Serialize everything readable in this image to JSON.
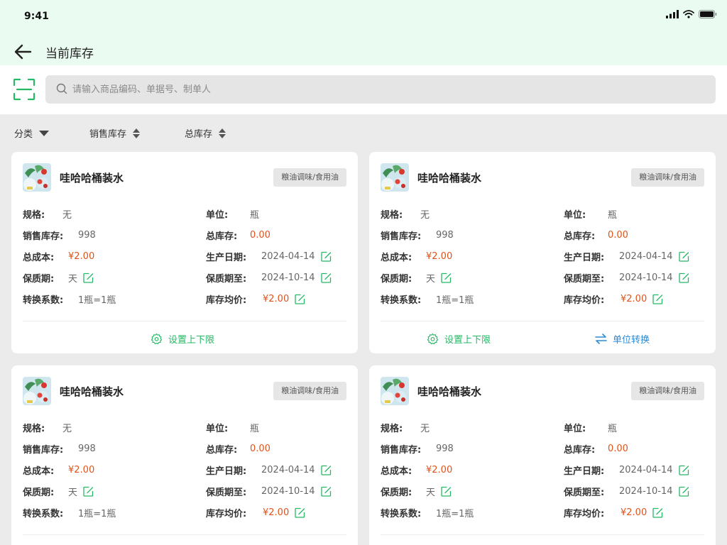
{
  "status": {
    "time": "9:41"
  },
  "header": {
    "title": "当前库存"
  },
  "search": {
    "placeholder": "请输入商品编码、单据号、制单人"
  },
  "filters": [
    {
      "label": "分类"
    },
    {
      "label": "销售库存"
    },
    {
      "label": "总库存"
    }
  ],
  "labels": {
    "spec": "规格:",
    "unit": "单位:",
    "sales_stock": "销售库存:",
    "total_stock": "总库存:",
    "total_cost": "总成本:",
    "prod_date": "生产日期:",
    "shelf_life": "保质期:",
    "expire": "保质期至:",
    "conversion": "转换系数:",
    "avg_price": "库存均价:"
  },
  "cards": [
    {
      "name": "哇哈哈桶装水",
      "category": "粮油调味/食用油",
      "spec": "无",
      "unit": "瓶",
      "sales_stock": "998",
      "total_stock": "0.00",
      "total_cost": "¥2.00",
      "prod_date": "2024-04-14",
      "shelf_life": "天",
      "expire": "2024-10-14",
      "conversion": "1瓶=1瓶",
      "avg_price": "¥2.00",
      "action_limit": "设置上下限"
    },
    {
      "name": "哇哈哈桶装水",
      "category": "粮油调味/食用油",
      "spec": "无",
      "unit": "瓶",
      "sales_stock": "998",
      "total_stock": "0.00",
      "total_cost": "¥2.00",
      "prod_date": "2024-04-14",
      "shelf_life": "天",
      "expire": "2024-10-14",
      "conversion": "1瓶=1瓶",
      "avg_price": "¥2.00",
      "action_limit": "设置上下限",
      "action_convert": "单位转换"
    },
    {
      "name": "哇哈哈桶装水",
      "category": "粮油调味/食用油",
      "spec": "无",
      "unit": "瓶",
      "sales_stock": "998",
      "total_stock": "0.00",
      "total_cost": "¥2.00",
      "prod_date": "2024-04-14",
      "shelf_life": "天",
      "expire": "2024-10-14",
      "conversion": "1瓶=1瓶",
      "avg_price": "¥2.00"
    },
    {
      "name": "哇哈哈桶装水",
      "category": "粮油调味/食用油",
      "spec": "无",
      "unit": "瓶",
      "sales_stock": "998",
      "total_stock": "0.00",
      "total_cost": "¥2.00",
      "prod_date": "2024-04-14",
      "shelf_life": "天",
      "expire": "2024-10-14",
      "conversion": "1瓶=1瓶",
      "avg_price": "¥2.00"
    }
  ],
  "colors": {
    "accent": "#25b865",
    "price": "#e0531b",
    "link_blue": "#2a8bd5"
  }
}
